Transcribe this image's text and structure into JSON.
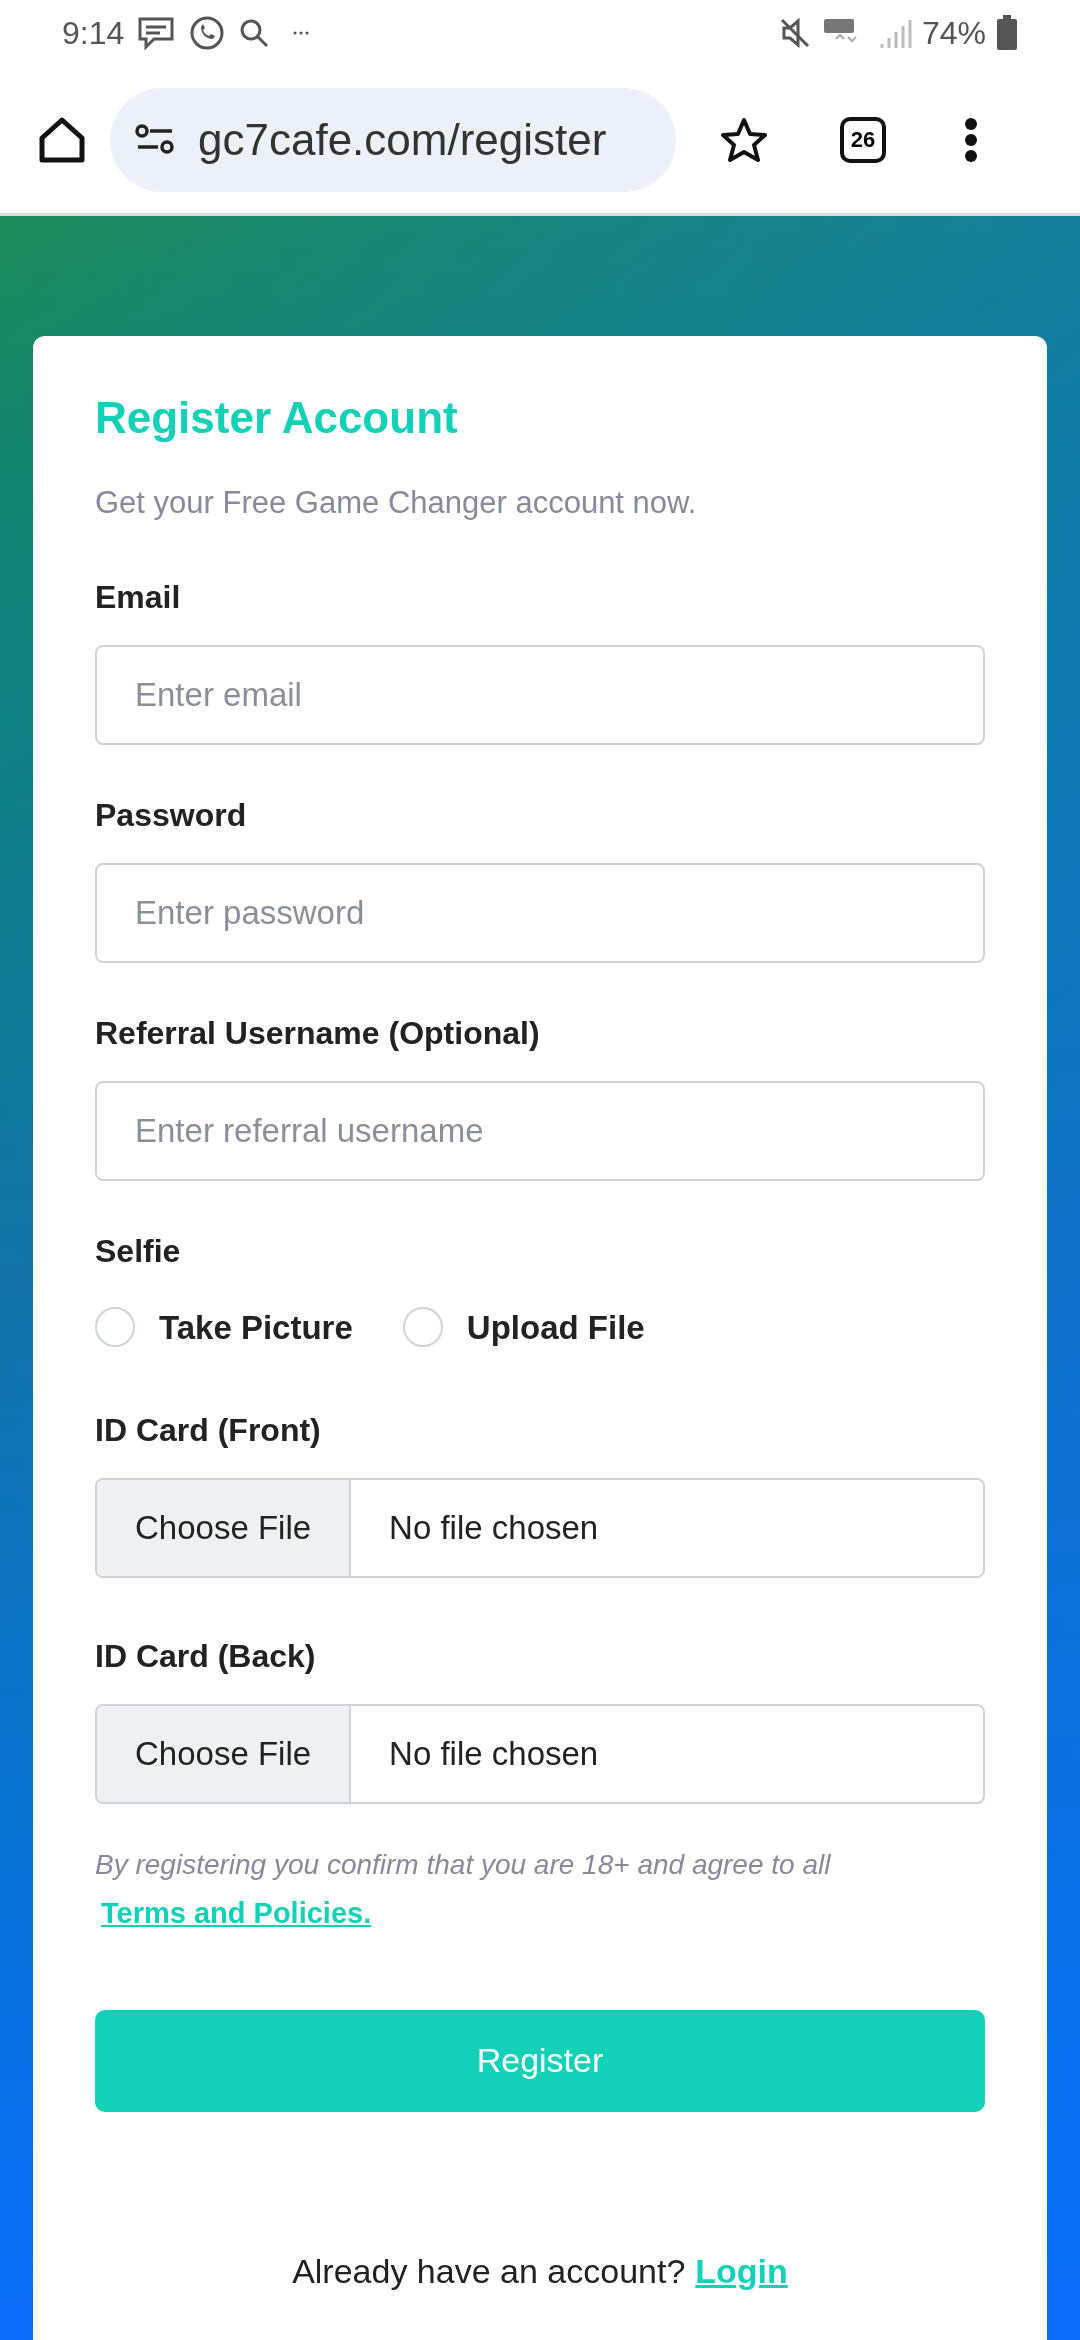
{
  "status_bar": {
    "time": "9:14",
    "battery": "74%"
  },
  "browser": {
    "url": "gc7cafe.com/register",
    "tab_count": "26"
  },
  "form": {
    "title": "Register Account",
    "subtitle": "Get your Free Game Changer account now.",
    "fields": [
      {
        "label": "Email",
        "placeholder": "Enter email"
      },
      {
        "label": "Password",
        "placeholder": "Enter password"
      },
      {
        "label": "Referral Username (Optional)",
        "placeholder": "Enter referral username"
      }
    ],
    "selfie": {
      "label": "Selfie",
      "options": [
        {
          "label": "Take Picture",
          "selected": false
        },
        {
          "label": "Upload File",
          "selected": false
        }
      ]
    },
    "files": [
      {
        "label": "ID Card (Front)",
        "button": "Choose File",
        "status": "No file chosen"
      },
      {
        "label": "ID Card (Back)",
        "button": "Choose File",
        "status": "No file chosen"
      }
    ],
    "disclaimer": "By registering you confirm that you are 18+ and agree to all",
    "terms_link": "Terms and Policies.",
    "submit": "Register",
    "login_prompt": "Already have an account?",
    "login_link": "Login"
  }
}
